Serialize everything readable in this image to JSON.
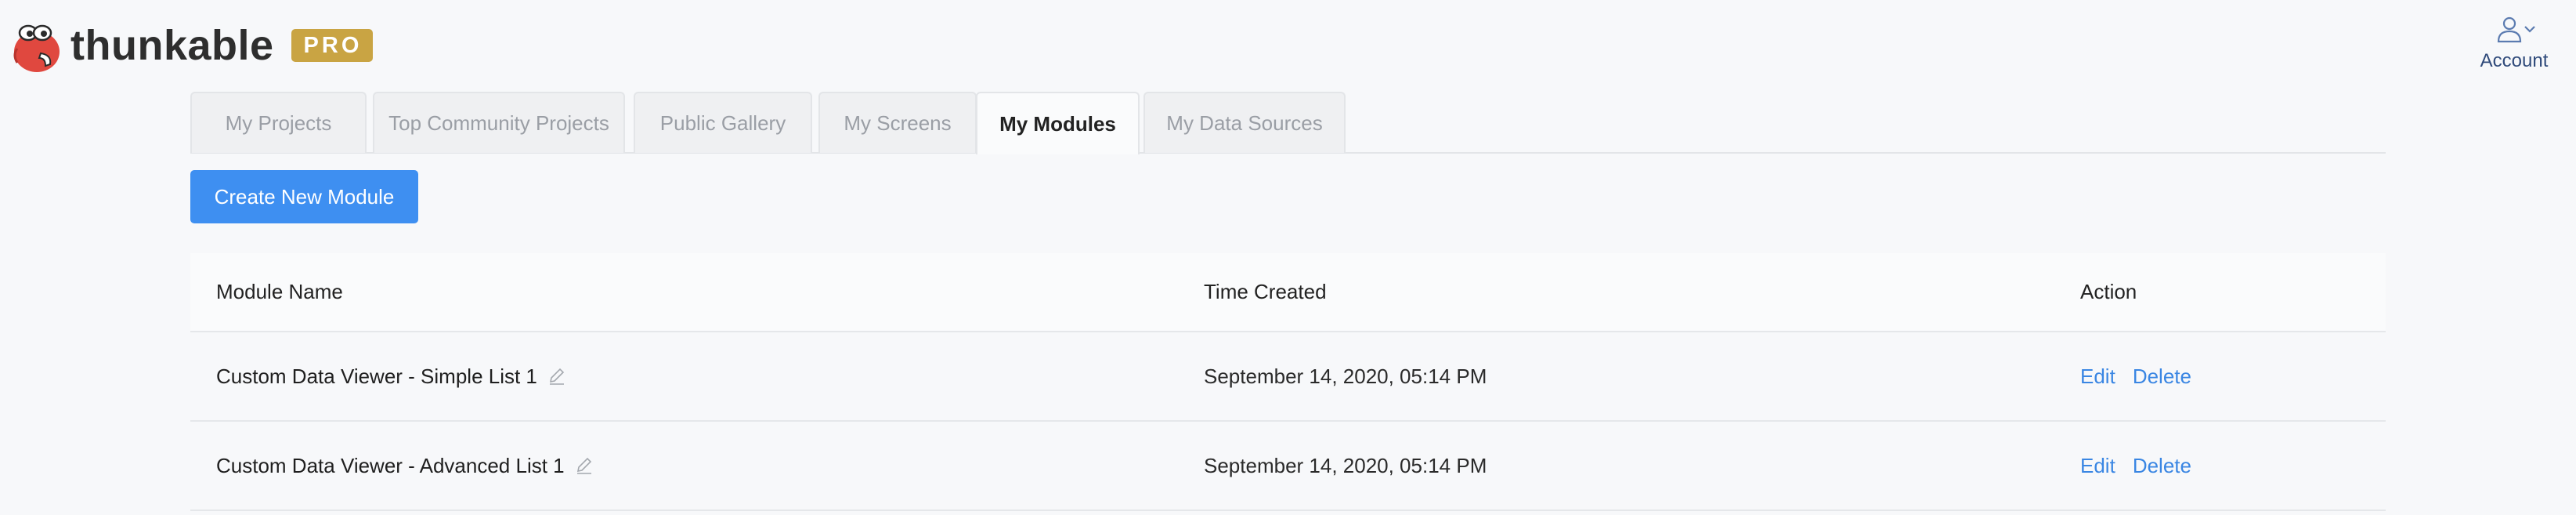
{
  "brand": {
    "name": "thunkable",
    "badge": "PRO",
    "colors": {
      "badge": "#c9a443",
      "mascot": "#e0483f"
    }
  },
  "account": {
    "label": "Account",
    "icon": "user-icon",
    "caret": "chevron-down-icon"
  },
  "tabs": [
    {
      "label": "My Projects",
      "active": false
    },
    {
      "label": "Top Community Projects",
      "active": false
    },
    {
      "label": "Public Gallery",
      "active": false
    },
    {
      "label": "My Screens",
      "active": false
    },
    {
      "label": "My Modules",
      "active": true
    },
    {
      "label": "My Data Sources",
      "active": false
    }
  ],
  "create_button": {
    "label": "Create New Module",
    "color": "#3e8ff1"
  },
  "table": {
    "headers": {
      "name": "Module Name",
      "time": "Time Created",
      "action": "Action"
    },
    "rows": [
      {
        "name": "Custom Data Viewer - Simple List 1",
        "time": "September 14, 2020, 05:14 PM",
        "edit": "Edit",
        "delete": "Delete"
      },
      {
        "name": "Custom Data Viewer - Advanced List 1",
        "time": "September 14, 2020, 05:14 PM",
        "edit": "Edit",
        "delete": "Delete"
      }
    ]
  },
  "link_color": "#3a86e3"
}
